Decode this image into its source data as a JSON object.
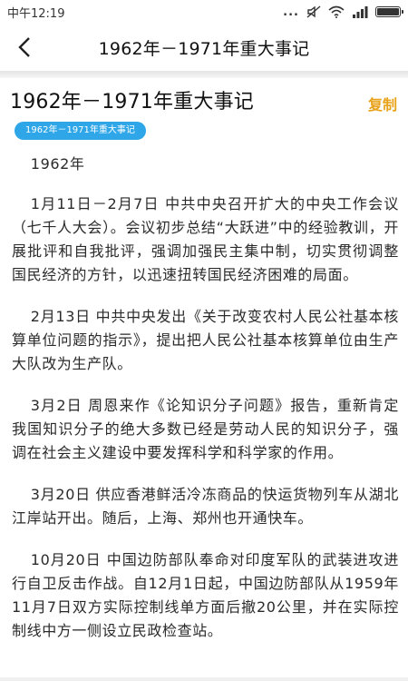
{
  "status_bar": {
    "time": "中午12:19",
    "dots": "...",
    "icons": [
      "mute-icon",
      "wifi-icon",
      "signal-icon",
      "battery-icon"
    ],
    "battery_level": 1.0
  },
  "nav": {
    "back_icon": "chevron-left-icon",
    "title": "1962年－1971年重大事记"
  },
  "article": {
    "title": "1962年－1971年重大事记",
    "copy_label": "复制",
    "tag": "1962年－1971年重大事记",
    "paragraphs": [
      "1962年",
      "1月11日－2月7日 中共中央召开扩大的中央工作会议（七千人大会）。会议初步总结“大跃进”中的经验教训，开展批评和自我批评，强调加强民主集中制，切实贯彻调整国民经济的方针，以迅速扭转国民经济困难的局面。",
      "2月13日 中共中央发出《关于改变农村人民公社基本核算单位问题的指示》，提出把人民公社基本核算单位由生产大队改为生产队。",
      "3月2日 周恩来作《论知识分子问题》报告，重新肯定我国知识分子的绝大多数已经是劳动人民的知识分子，强调在社会主义建设中要发挥科学和科学家的作用。",
      "3月20日 供应香港鲜活冷冻商品的快运货物列车从湖北江岸站开出。随后，上海、郑州也开通快车。",
      "10月20日 中国边防部队奉命对印度军队的武装进攻进行自卫反击作战。自12月1日起，中国边防部队从1959年11月7日双方实际控制线单方面后撤20公里，并在实际控制线中方一侧设立民政检查站。"
    ]
  },
  "colors": {
    "accent_copy": "#e8a21a",
    "tag_bg": "#2ea6e8"
  }
}
